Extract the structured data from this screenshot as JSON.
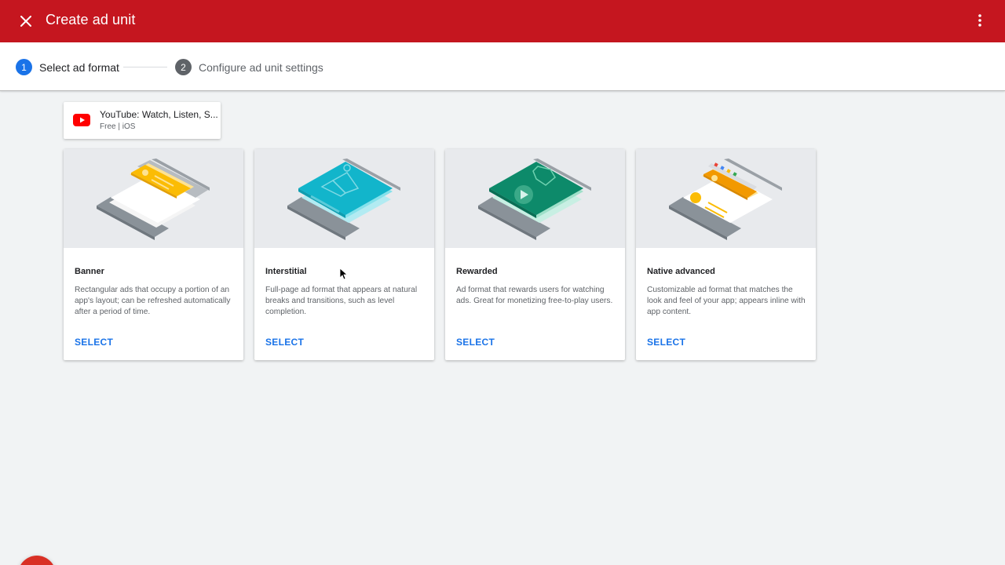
{
  "header": {
    "title": "Create ad unit",
    "close_icon": "close-icon",
    "menu_icon": "more-vert-icon",
    "color": "#c5161f"
  },
  "stepper": {
    "steps": [
      {
        "number": "1",
        "label": "Select ad format",
        "state": "active"
      },
      {
        "number": "2",
        "label": "Configure ad unit settings",
        "state": "inactive"
      }
    ]
  },
  "app": {
    "icon": "youtube-icon",
    "name": "YouTube: Watch, Listen, S...",
    "meta": "Free | iOS"
  },
  "formats": [
    {
      "title": "Banner",
      "description": "Rectangular ads that occupy a portion of an app's layout; can be refreshed automatically after a period of time.",
      "action": "SELECT",
      "accent": "#fbbc04"
    },
    {
      "title": "Interstitial",
      "description": "Full-page ad format that appears at natural breaks and transitions, such as level completion.",
      "action": "SELECT",
      "accent": "#12b5cb"
    },
    {
      "title": "Rewarded",
      "description": "Ad format that rewards users for watching ads. Great for monetizing free-to-play users.",
      "action": "SELECT",
      "accent": "#0d8a6a"
    },
    {
      "title": "Native advanced",
      "description": "Customizable ad format that matches the look and feel of your app; appears inline with app content.",
      "action": "SELECT",
      "accent": "#f29900"
    }
  ],
  "colors": {
    "link": "#1a73e8",
    "active_step": "#1a73e8",
    "inactive_step": "#5f6368"
  }
}
